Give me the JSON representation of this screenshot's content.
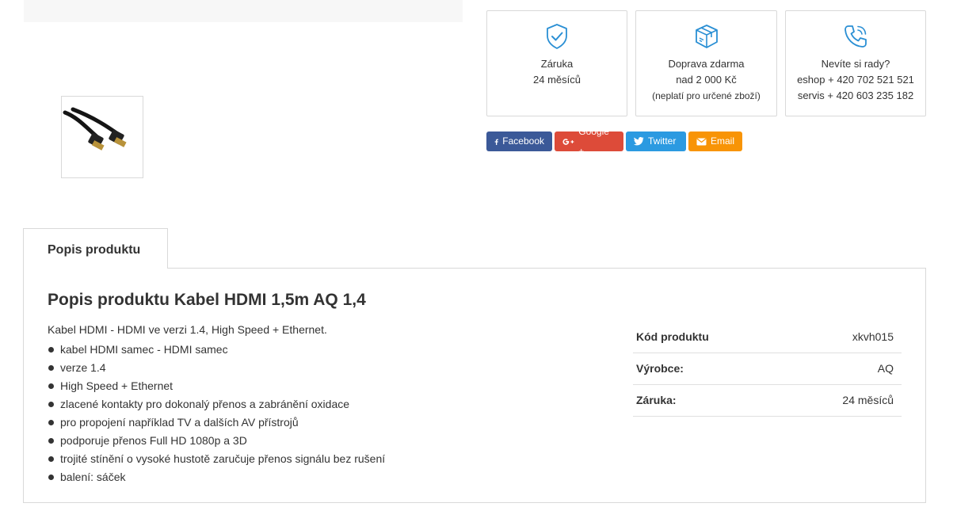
{
  "info_boxes": {
    "warranty": {
      "icon": "shield-check-icon",
      "line1": "Záruka",
      "line2": "24 měsíců"
    },
    "shipping": {
      "icon": "package-icon",
      "line1": "Doprava zdarma",
      "line2": "nad 2 000 Kč",
      "line3": "(neplatí pro určené zboží)"
    },
    "help": {
      "icon": "phone-icon",
      "line1": "Nevíte si rady?",
      "line2": "eshop + 420 702 521 521",
      "line3": "servis + 420 603 235 182"
    }
  },
  "share": {
    "facebook": {
      "label": "Facebook",
      "color": "#3b5998"
    },
    "google": {
      "label": "Google +",
      "color": "#dd4b39"
    },
    "twitter": {
      "label": "Twitter",
      "color": "#2b9ae1"
    },
    "email": {
      "label": "Email",
      "color": "#f89406"
    }
  },
  "accent_color": "#2a8fd4",
  "tab": {
    "label": "Popis produktu"
  },
  "description": {
    "title": "Popis produktu Kabel HDMI 1,5m AQ 1,4",
    "intro": "Kabel HDMI - HDMI ve verzi 1.4, High Speed + Ethernet.",
    "features": [
      "kabel HDMI samec - HDMI samec",
      "verze 1.4",
      "High Speed + Ethernet",
      "zlacené kontakty pro dokonalý přenos a zabránění oxidace",
      "pro propojení například TV a dalších AV přístrojů",
      "podporuje přenos Full HD 1080p a 3D",
      "trojité stínění o vysoké hustotě zaručuje přenos signálu bez rušení",
      "balení: sáček"
    ]
  },
  "specs": [
    {
      "key": "Kód produktu",
      "value": "xkvh015"
    },
    {
      "key": "Výrobce:",
      "value": "AQ"
    },
    {
      "key": "Záruka:",
      "value": "24 měsíců"
    }
  ]
}
